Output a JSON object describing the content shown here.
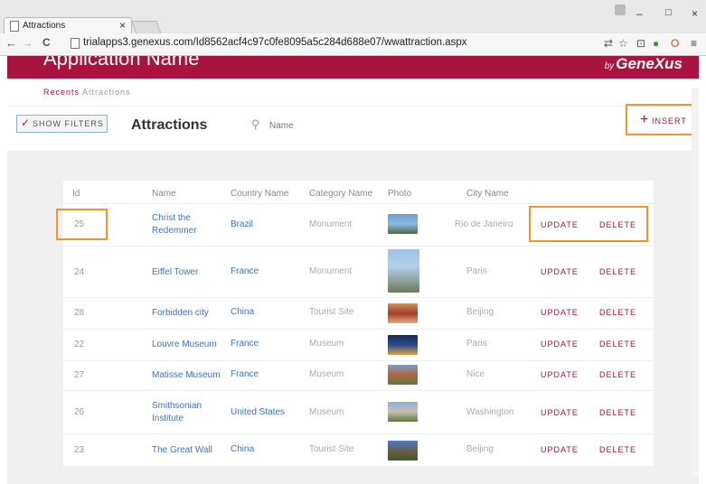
{
  "browser": {
    "tab_title": "Attractions",
    "tab_close": "×",
    "url": "trialapps3.genexus.com/Id8562acf4c97c0fe8095a5c284d688e07/wwattraction.aspx",
    "back": "←",
    "forward": "→",
    "reload": "C",
    "minimize": "–",
    "maximize": "□",
    "close": "×"
  },
  "header": {
    "app_name": "Application Name",
    "brand_prefix": "by",
    "brand": "GeneXus"
  },
  "breadcrumb": {
    "recents": "Recents",
    "current": "Attractions"
  },
  "toolbar": {
    "filters_label": "SHOW FILTERS",
    "title": "Attractions",
    "search_placeholder": "Name",
    "insert_label": "INSERT"
  },
  "table": {
    "headers": [
      "Id",
      "Name",
      "Country Name",
      "Category Name",
      "Photo",
      "City Name"
    ],
    "rows": [
      {
        "id": "25",
        "name": "Christ the Redemmer",
        "country": "Brazil",
        "category": "Monument",
        "city": "Rio de Janeiro",
        "update": "UPDATE",
        "delete": "DELETE",
        "photo": "christ-redeemer-photo"
      },
      {
        "id": "24",
        "name": "Eiffel Tower",
        "country": "France",
        "category": "Monument",
        "city": "Paris",
        "update": "UPDATE",
        "delete": "DELETE",
        "photo": "eiffel-tower-photo"
      },
      {
        "id": "28",
        "name": "Forbidden city",
        "country": "China",
        "category": "Tourist Site",
        "city": "Beijing",
        "update": "UPDATE",
        "delete": "DELETE",
        "photo": "forbidden-city-photo"
      },
      {
        "id": "22",
        "name": "Louvre Museum",
        "country": "France",
        "category": "Museum",
        "city": "Paris",
        "update": "UPDATE",
        "delete": "DELETE",
        "photo": "louvre-photo"
      },
      {
        "id": "27",
        "name": "Matisse Museum",
        "country": "France",
        "category": "Museum",
        "city": "Nice",
        "update": "UPDATE",
        "delete": "DELETE",
        "photo": "matisse-museum-photo"
      },
      {
        "id": "26",
        "name": "Smithsonian Institute",
        "country": "United States",
        "category": "Museum",
        "city": "Washington",
        "update": "UPDATE",
        "delete": "DELETE",
        "photo": "smithsonian-photo"
      },
      {
        "id": "23",
        "name": "The Great Wall",
        "country": "China",
        "category": "Tourist Site",
        "city": "Beijing",
        "update": "UPDATE",
        "delete": "DELETE",
        "photo": "great-wall-photo"
      }
    ]
  },
  "colors": {
    "brand": "#a8143f",
    "highlight": "#f0962c",
    "link": "#3b74c6"
  }
}
